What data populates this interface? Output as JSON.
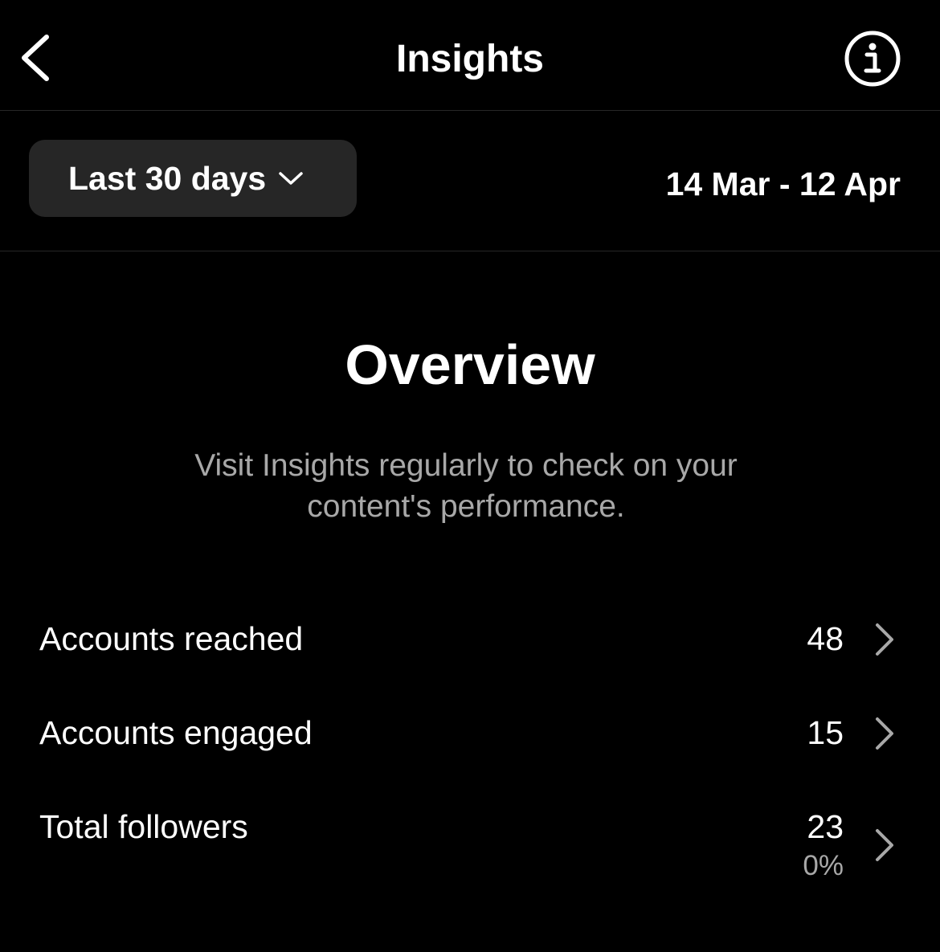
{
  "header": {
    "title": "Insights",
    "back_icon": "chevron-left-icon",
    "info_icon": "info-circle-icon"
  },
  "filter": {
    "range_label": "Last 30 days",
    "dropdown_icon": "chevron-down-icon",
    "date_range": "14 Mar - 12 Apr"
  },
  "overview": {
    "title": "Overview",
    "subtitle": "Visit Insights regularly to check on your content's performance."
  },
  "metrics": [
    {
      "label": "Accounts reached",
      "value": "48"
    },
    {
      "label": "Accounts engaged",
      "value": "15"
    },
    {
      "label": "Total followers",
      "value": "23",
      "change": "0%"
    }
  ],
  "colors": {
    "background": "#000000",
    "text": "#ffffff",
    "secondary_text": "#a8a8a8",
    "button_bg": "#262626",
    "divider": "#262626"
  }
}
